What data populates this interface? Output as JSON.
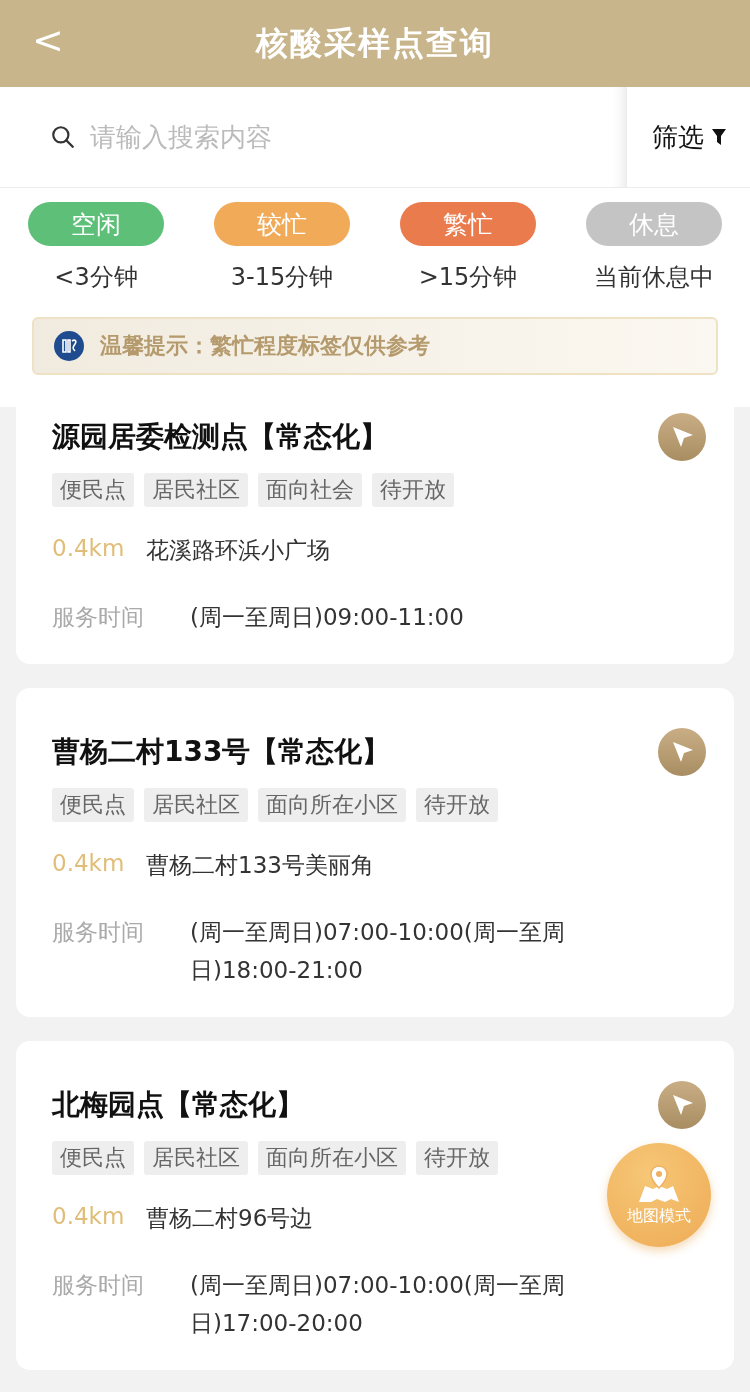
{
  "header": {
    "back": "<",
    "title": "核酸采样点查询"
  },
  "search": {
    "placeholder": "请输入搜索内容"
  },
  "filter": {
    "label": "筛选"
  },
  "legend": [
    {
      "label": "空闲",
      "description": "<3分钟",
      "color": "#5dbf78"
    },
    {
      "label": "较忙",
      "description": "3-15分钟",
      "color": "#f0aa58"
    },
    {
      "label": "繁忙",
      "description": ">15分钟",
      "color": "#ea7b4d"
    },
    {
      "label": "休息",
      "description": "当前休息中",
      "color": "#c4c4c4"
    }
  ],
  "notice": {
    "text": "温馨提示：繁忙程度标签仅供参考"
  },
  "sites": [
    {
      "name": "源园居委检测点【常态化】",
      "tags": [
        "便民点",
        "居民社区",
        "面向社会",
        "待开放"
      ],
      "distance": "0.4km",
      "address": "花溪路环浜小广场",
      "hours_label": "服务时间",
      "hours": "(周一至周日)09:00-11:00"
    },
    {
      "name": "曹杨二村133号【常态化】",
      "tags": [
        "便民点",
        "居民社区",
        "面向所在小区",
        "待开放"
      ],
      "distance": "0.4km",
      "address": "曹杨二村133号美丽角",
      "hours_label": "服务时间",
      "hours": "(周一至周日)07:00-10:00(周一至周日)18:00-21:00"
    },
    {
      "name": "北梅园点【常态化】",
      "tags": [
        "便民点",
        "居民社区",
        "面向所在小区",
        "待开放"
      ],
      "distance": "0.4km",
      "address": "曹杨二村96号边",
      "hours_label": "服务时间",
      "hours": "(周一至周日)07:00-10:00(周一至周日)17:00-20:00"
    }
  ],
  "map_button": {
    "label": "地图模式"
  }
}
